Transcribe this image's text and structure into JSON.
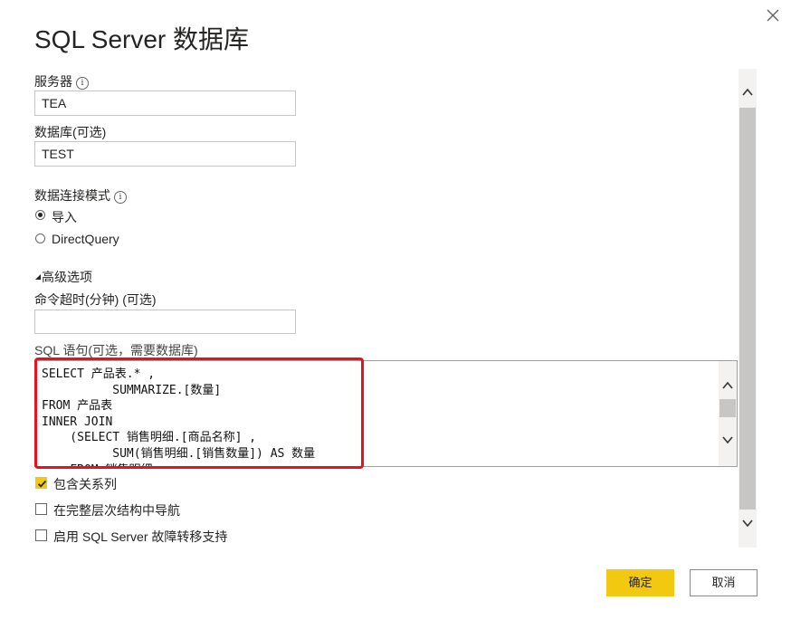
{
  "dialog": {
    "title": "SQL Server 数据库",
    "close_icon": "close-icon"
  },
  "server": {
    "label": "服务器",
    "value": "TEA"
  },
  "database": {
    "label": "数据库(可选)",
    "value": "TEST"
  },
  "connectivity": {
    "label": "数据连接模式",
    "options": [
      {
        "label": "导入",
        "selected": true
      },
      {
        "label": "DirectQuery",
        "selected": false
      }
    ]
  },
  "advanced": {
    "toggle_label": "高级选项",
    "timeout_label": "命令超时(分钟) (可选)",
    "timeout_value": "",
    "sql_label": "SQL 语句(可选，需要数据库)",
    "sql_text": "SELECT 产品表.* ,\n          SUMMARIZE.[数量]\nFROM 产品表\nINNER JOIN\n    (SELECT 销售明细.[商品名称] ,\n          SUM(销售明细.[销售数量]) AS 数量\n    FROM 销售明细",
    "checkboxes": [
      {
        "label": "包含关系列",
        "checked": true
      },
      {
        "label": "在完整层次结构中导航",
        "checked": false
      },
      {
        "label": "启用 SQL Server 故障转移支持",
        "checked": false
      }
    ]
  },
  "buttons": {
    "ok_label": "确定",
    "cancel_label": "取消"
  },
  "colors": {
    "accent": "#f2c811",
    "highlight": "#e81123"
  }
}
